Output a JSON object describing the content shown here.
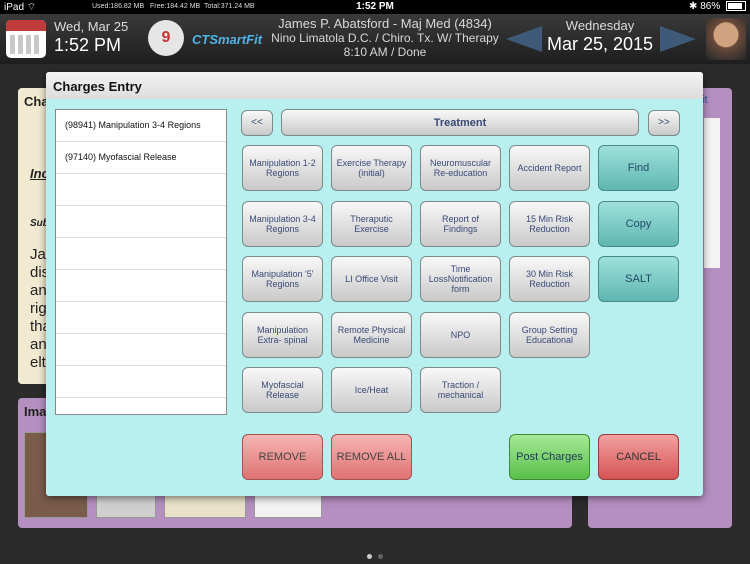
{
  "status_bar": {
    "device": "iPad",
    "wifi_icon": "wifi-icon",
    "time": "1:52 PM",
    "battery_pct": "86%",
    "battery_level": 0.86,
    "mem_used": "Used:186.82 MB",
    "mem_free": "Free:184.42 MB",
    "mem_total": "Total:371.24 MB"
  },
  "header": {
    "date_short": "Wed, Mar 25",
    "time": "1:52 PM",
    "logo_text": "9",
    "brand": "CTSmartFit",
    "patient_name": "James P. Abatsford - Maj Med (4834)",
    "provider": "Nino Limatola D.C. / Chiro. Tx. W/ Therapy",
    "appointment": "8:10 AM / Done",
    "weekday": "Wednesday",
    "full_date": "Mar 25, 2015"
  },
  "background": {
    "left_panel_title": "Cha",
    "text_fragments": [
      "Inc",
      "Sub",
      "Ja",
      "dis",
      "an",
      "rig",
      "tha",
      "an",
      "elt"
    ],
    "image_panel_title": "Ima",
    "right_panel_link": "it"
  },
  "modal": {
    "title": "Charges Entry",
    "selected_codes": [
      "(98941) Manipulation 3-4 Regions",
      "(97140) Myofascial Release"
    ],
    "nav_prev": "<<",
    "category": "Treatment",
    "nav_next": ">>",
    "buttons": [
      "Manipulation 1-2 Regions",
      "Exercise Therapy (initial)",
      "Neuromuscular Re-education",
      "Accident Report",
      "Manipulation 3-4 Regions",
      "Theraputic Exercise",
      "Report of Findings",
      "15 Min Risk Reduction",
      "Manipulation '5' Regions",
      "LI Office Visit",
      "Time LossNotification form",
      "30 Min Risk Reduction",
      "Manipulation Extra- spinal",
      "Remote Physical Medicine",
      "NPO",
      "Group Setting Educational",
      "Myofascial Release",
      "Ice/Heat",
      "Traction / mechanical"
    ],
    "side_actions": [
      "Find",
      "Copy",
      "SALT"
    ],
    "remove": "REMOVE",
    "remove_all": "REMOVE ALL",
    "post": "Post Charges",
    "cancel": "CANCEL"
  },
  "colors": {
    "modal_bg": "#b8f0ef",
    "teal_button": "#5fb6b2",
    "remove_button": "#e07272",
    "post_button": "#58c04a",
    "cancel_button": "#d55454",
    "header_bg": "#2a2a2a",
    "panel_purple": "#b48fc0"
  }
}
